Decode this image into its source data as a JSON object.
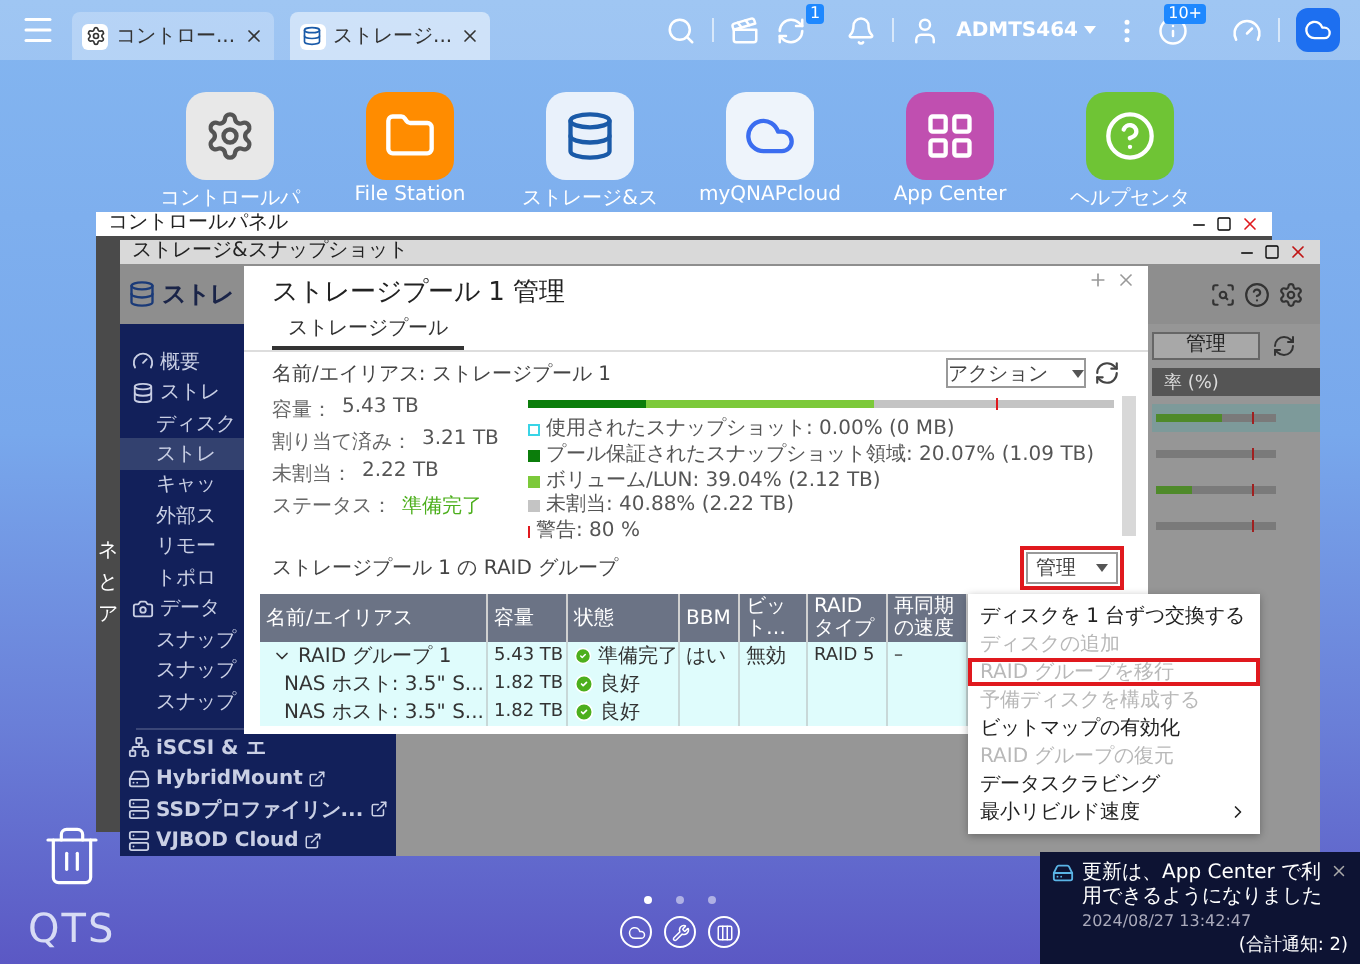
{
  "topbar": {
    "tabs": [
      {
        "label": "コントロー...",
        "selected": false
      },
      {
        "label": "ストレージ...",
        "selected": true
      }
    ],
    "sync_badge": "1",
    "user": "ADMTS464",
    "info_badge": "10+"
  },
  "desktop_icons": [
    {
      "label": "コントロールパ"
    },
    {
      "label": "File Station"
    },
    {
      "label": "ストレージ&ス"
    },
    {
      "label": "myQNAPcloud"
    },
    {
      "label": "App Center"
    },
    {
      "label": "ヘルプセンタ"
    }
  ],
  "control_panel_window": {
    "title": "コントロールパネル",
    "side_fragments": [
      "ネ",
      "と",
      "ア"
    ]
  },
  "storage_window": {
    "title": "ストレージ&スナップショット",
    "header": "ストレ",
    "sidebar": [
      {
        "label": "概要",
        "selected": false
      },
      {
        "label": "ストレ",
        "selected": false,
        "children": [
          {
            "label": "ディスク",
            "selected": false
          },
          {
            "label": "ストレ",
            "selected": true
          },
          {
            "label": "キャッ",
            "selected": false
          },
          {
            "label": "外部ス",
            "selected": false
          },
          {
            "label": "リモー",
            "selected": false
          },
          {
            "label": "トポロ",
            "selected": false
          }
        ]
      },
      {
        "label": "データ",
        "selected": false,
        "children": [
          {
            "label": "スナップ",
            "selected": false
          },
          {
            "label": "スナップ",
            "selected": false
          },
          {
            "label": "スナップ",
            "selected": false
          }
        ]
      }
    ],
    "apps": [
      {
        "label": "iSCSI & エ",
        "external": false
      },
      {
        "label": "HybridMount",
        "external": true
      },
      {
        "label": "SSDプロファイリン...",
        "external": true
      },
      {
        "label": "VJBOD Cloud",
        "external": true
      }
    ],
    "manage_button": "管理",
    "column_header": "率 (%)",
    "usage_rows": [
      {
        "level": 0.55,
        "selected": true
      },
      {
        "level": 0,
        "selected": false
      },
      {
        "level": 0.3,
        "selected": false
      },
      {
        "level": 0,
        "selected": false
      }
    ]
  },
  "dialog": {
    "title": "ストレージプール 1 管理",
    "tabs": [
      {
        "label": "ストレージプール",
        "selected": true
      }
    ],
    "name_line": "名前/エイリアス: ストレージプール 1",
    "info": [
      {
        "label": "容量：",
        "value": "5.43 TB",
        "kind": "plain"
      },
      {
        "label": "割り当て済み：",
        "value": "3.21 TB",
        "kind": "plain"
      },
      {
        "label": "未割当：",
        "value": "2.22 TB",
        "kind": "plain"
      },
      {
        "label": "ステータス：",
        "value": "準備完了",
        "kind": "status"
      }
    ],
    "action_button": "アクション",
    "usage_bar": {
      "segments": [
        {
          "level": 0.2,
          "color": "#0b7d0b"
        },
        {
          "level": 0.39,
          "color": "#7cc93a"
        }
      ],
      "warning": {
        "level": 0.8
      }
    },
    "legend": [
      [
        {
          "kind": "outline",
          "color": "#39d4e6",
          "text": "使用されたスナップショット: 0.00% (0 MB)"
        }
      ],
      [
        {
          "kind": "square",
          "color": "#0b7d0b",
          "text": "プール保証されたスナップショット領域: 20.07% (1.09 TB)"
        }
      ],
      [
        {
          "kind": "square",
          "color": "#7cc93a",
          "text": "ボリューム/LUN: 39.04% (2.12 TB)"
        },
        {
          "kind": "square",
          "color": "#c4c4c4",
          "text": "未割当: 40.88% (2.22 TB)"
        }
      ],
      [
        {
          "kind": "line",
          "color": "#e0191e",
          "text": "警告: 80 %"
        }
      ]
    ],
    "raid_title": "ストレージプール 1 の RAID グループ",
    "manage_button": {
      "label": "管理",
      "highlighted": true
    },
    "table": {
      "columns": [
        "名前/エイリアス",
        "容量",
        "状態",
        "BBM",
        "ビット…",
        "RAID タイプ",
        "再同期の速度"
      ],
      "rows": [
        {
          "kind": "group",
          "expanded": true,
          "cells": [
            "RAID グループ 1",
            "5.43 TB",
            "準備完了",
            "はい",
            "無効",
            "RAID 5",
            "–"
          ]
        },
        {
          "kind": "disk",
          "cells": [
            "NAS ホスト: 3.5\" S...",
            "1.82 TB",
            "良好",
            "",
            "",
            "",
            ""
          ]
        },
        {
          "kind": "disk",
          "cells": [
            "NAS ホスト: 3.5\" S...",
            "1.82 TB",
            "良好",
            "",
            "",
            "",
            ""
          ]
        }
      ]
    }
  },
  "menu": [
    {
      "label": "ディスクを 1 台ずつ交換する",
      "disabled": false,
      "highlighted": false,
      "kind": "action"
    },
    {
      "label": "ディスクの追加",
      "disabled": true,
      "highlighted": false,
      "kind": "action"
    },
    {
      "label": "RAID グループを移行",
      "disabled": true,
      "highlighted": true,
      "kind": "action"
    },
    {
      "label": "予備ディスクを構成する",
      "disabled": true,
      "highlighted": false,
      "kind": "action"
    },
    {
      "label": "ビットマップの有効化",
      "disabled": false,
      "highlighted": false,
      "kind": "action"
    },
    {
      "label": "RAID グループの復元",
      "disabled": true,
      "highlighted": false,
      "kind": "action"
    },
    {
      "label": "データスクラビング",
      "disabled": false,
      "highlighted": false,
      "kind": "action"
    },
    {
      "label": "最小リビルド速度",
      "disabled": false,
      "highlighted": false,
      "kind": "submenu"
    }
  ],
  "notification": {
    "message": "更新は、App Center で利用できるようになりました",
    "time": "2024/08/27 13:42:47",
    "count": "(合計通知: 2)"
  },
  "logo": "QTS",
  "dock": {
    "pages": [
      {
        "selected": true
      },
      {
        "selected": false
      },
      {
        "selected": false
      }
    ]
  }
}
